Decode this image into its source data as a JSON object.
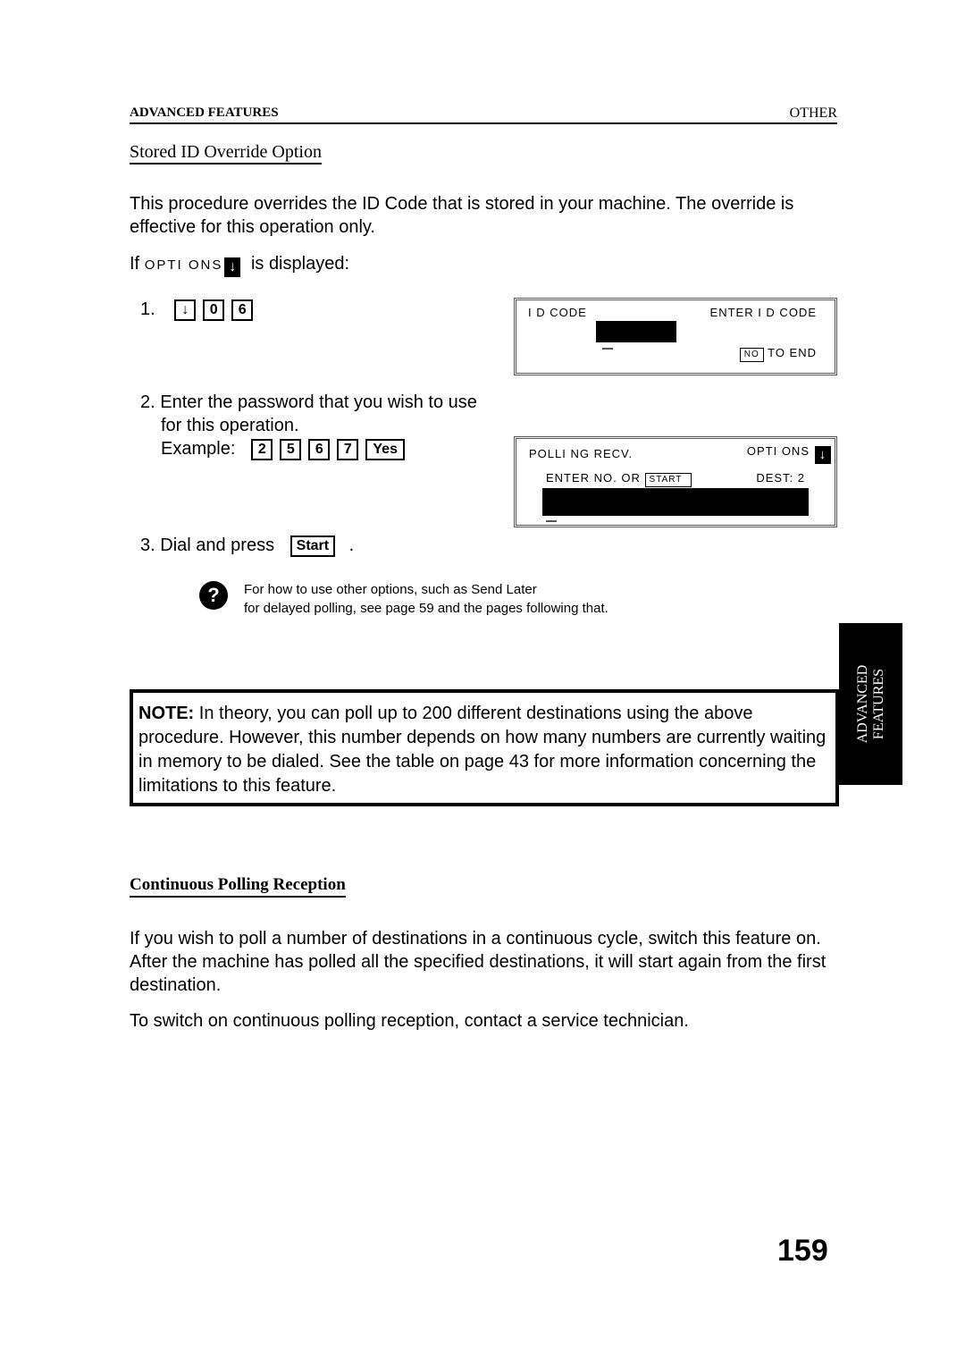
{
  "header": {
    "section": "ADVANCED FEATURES",
    "chapter": "OTHER"
  },
  "section1": {
    "title": "Stored ID Override Option",
    "intro": "This procedure overrides the ID Code  that is stored in your machine. The override is effective for this operation only.",
    "if_prefix": "If",
    "if_display_word": "OPTI ONS",
    "if_display_icon": "down-arrow-icon",
    "if_suffix": "is displayed:",
    "steps": [
      {
        "number": "1.",
        "keys": [
          "↓",
          "0",
          "6"
        ]
      },
      {
        "number": "2.",
        "text_line1": "Enter the password that you wish to use",
        "text_line2": "for this operation.",
        "example_label": "Example:",
        "keys": [
          "2",
          "5",
          "6",
          "7",
          "Yes"
        ]
      },
      {
        "number": "3.",
        "text": "Dial and press",
        "key": "Start",
        "after": "."
      }
    ],
    "lcd1": {
      "top_left": "I D CODE",
      "top_right": "ENTER I D CODE",
      "key": "NO",
      "key_suffix": "TO END"
    },
    "lcd2": {
      "top_left": "POLLI NG RECV.",
      "top_right": "OPTI ONS",
      "top_right_icon": "down-arrow-icon",
      "line2_left": "ENTER NO.  OR",
      "line2_key": "START",
      "line2_right": "DEST:  2"
    },
    "tip": {
      "icon": "question-icon",
      "glyph": "?",
      "line1": "For how to use other options, such as Send Later",
      "line2": "for delayed polling, see page 59 and the pages following that."
    }
  },
  "note": {
    "label": "NOTE:",
    "text": " In theory, you can poll up to 200 different destinations using the above procedure. However, this number depends on how many numbers are currently waiting in memory to be dialed. See the table on page   43 for more information concerning the limitations to this feature."
  },
  "side_tab": {
    "line1": "ADVANCED",
    "line2": "FEATURES"
  },
  "section2": {
    "title": "Continuous Polling Reception",
    "paragraph1": "If you wish to poll a number of destinations in a continuous cycle, switch this feature on. After the machine has polled all the specified destinations, it will start again from the first destination.",
    "paragraph2": "To switch on continuous polling reception, contact a service technician."
  },
  "page_number": "159"
}
